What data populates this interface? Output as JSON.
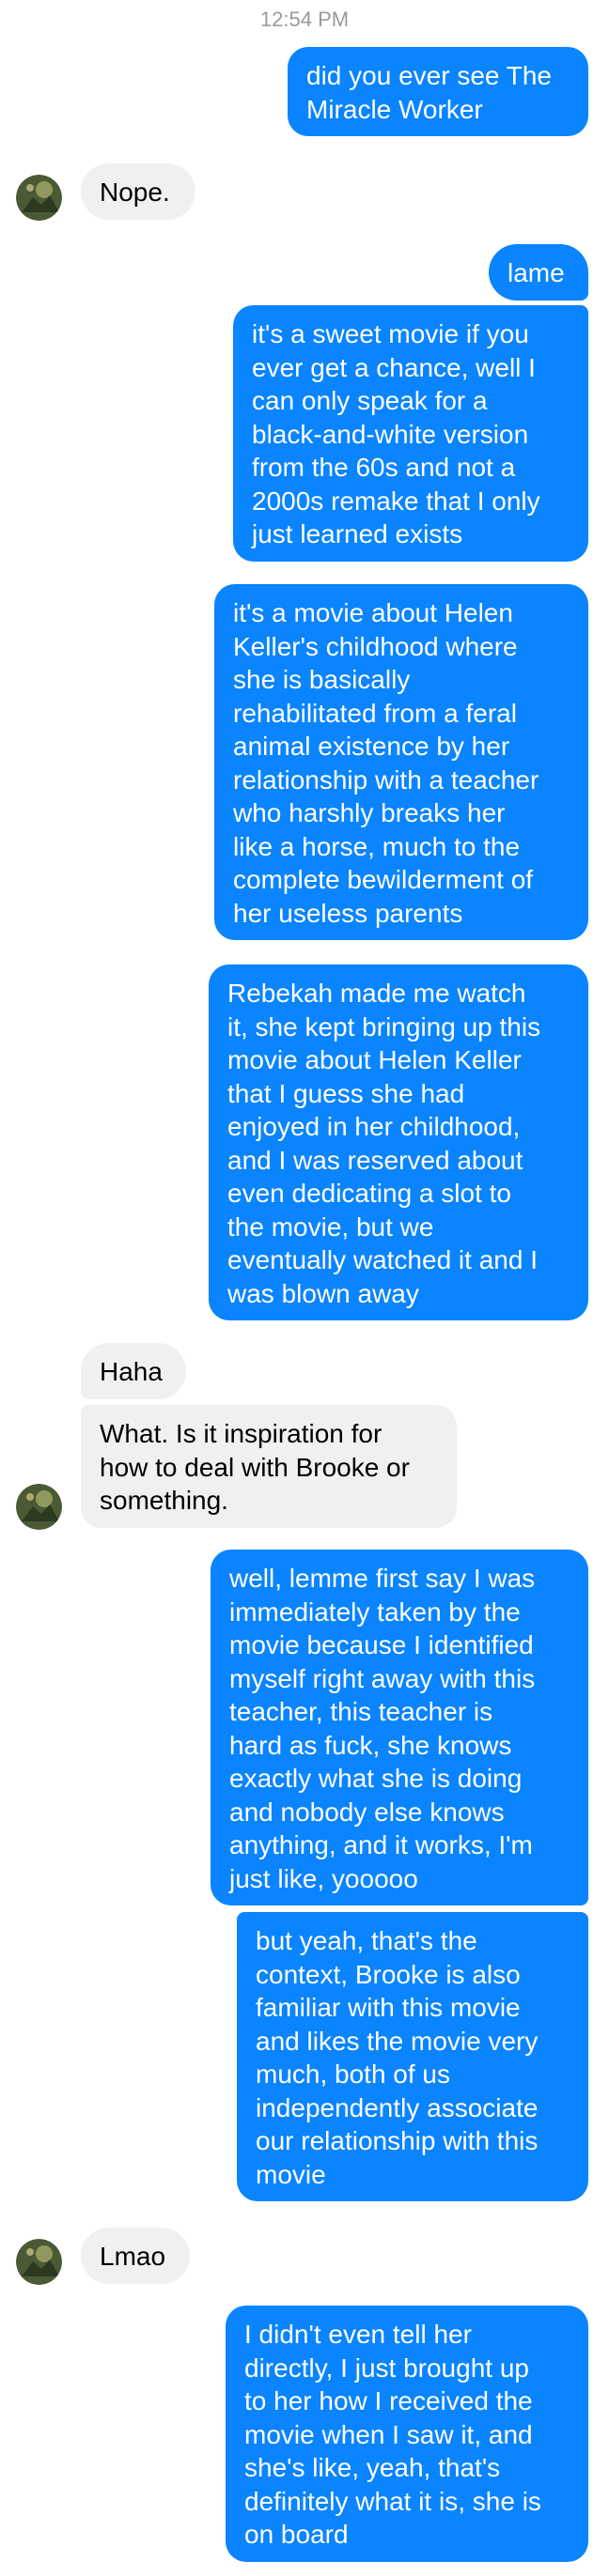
{
  "timestamp": "12:54 PM",
  "contact": {
    "avatar_icon": "contact-avatar"
  },
  "colors": {
    "outgoing_bubble": "#0a84ff",
    "incoming_bubble": "#f1f0f0"
  },
  "messages": [
    {
      "direction": "outgoing",
      "text": "did you ever see The\nMiracle Worker"
    },
    {
      "direction": "incoming",
      "text": "Nope."
    },
    {
      "direction": "outgoing",
      "text": "lame"
    },
    {
      "direction": "outgoing",
      "text": "it's a sweet movie if you\never get a chance, well I\ncan only speak for a\nblack-and-white version\nfrom the 60s and not a\n2000s remake that I only\njust learned exists"
    },
    {
      "direction": "outgoing",
      "text": "it's a movie about Helen\nKeller's childhood where\nshe is basically\nrehabilitated from a feral\nanimal existence by her\nrelationship with a teacher\nwho harshly breaks her\nlike a horse, much to the\ncomplete bewilderment of\nher useless parents"
    },
    {
      "direction": "outgoing",
      "text": "Rebekah made me watch\nit, she kept bringing up this\nmovie about Helen Keller\nthat I guess she had\nenjoyed in her childhood,\nand I was reserved about\neven dedicating a slot to\nthe movie, but we\neventually watched it and I\nwas blown away"
    },
    {
      "direction": "incoming",
      "text": "Haha"
    },
    {
      "direction": "incoming",
      "text": "What. Is it inspiration for\nhow to deal with Brooke or\nsomething."
    },
    {
      "direction": "outgoing",
      "text": "well, lemme first say I was\nimmediately taken by the\nmovie because I identified\nmyself right away with this\nteacher, this teacher is\nhard as fuck, she knows\nexactly what she is doing\nand nobody else knows\nanything, and it works, I'm\njust like, yooooo"
    },
    {
      "direction": "outgoing",
      "text": "but yeah, that's the\ncontext, Brooke is also\nfamiliar with this movie\nand likes the movie very\nmuch, both of us\nindependently associate\nour relationship with this\nmovie"
    },
    {
      "direction": "incoming",
      "text": "Lmao"
    },
    {
      "direction": "outgoing",
      "text": "I didn't even tell her\ndirectly, I just brought up\nto her how I received the\nmovie when I saw it, and\nshe's like, yeah, that's\ndefinitely what it is, she is\non board"
    }
  ]
}
